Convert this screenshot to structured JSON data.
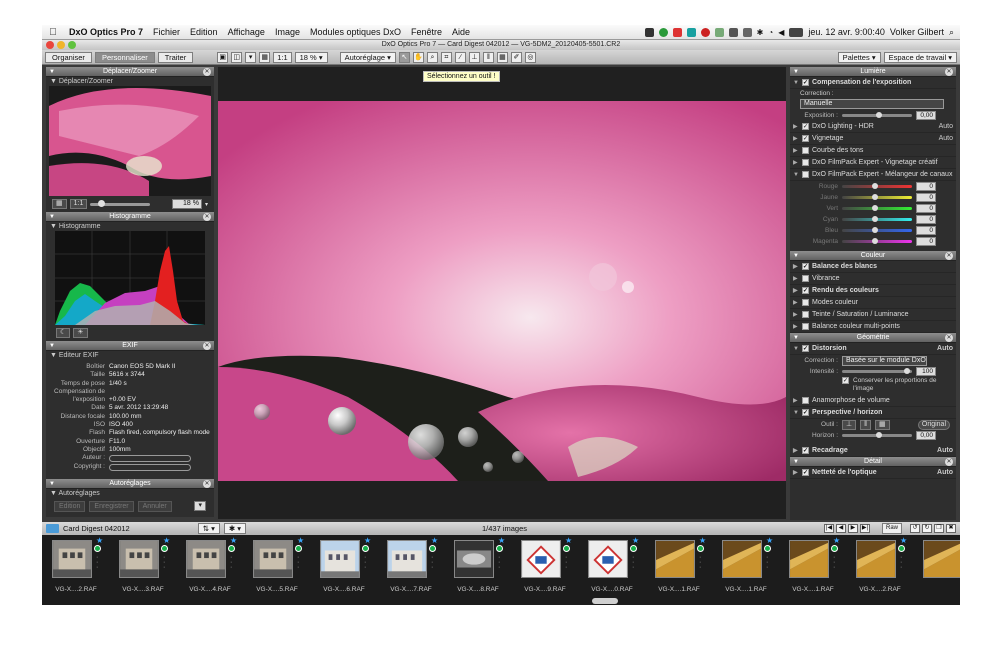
{
  "menubar": {
    "app_name": "DxO Optics Pro 7",
    "items": [
      "Fichier",
      "Edition",
      "Affichage",
      "Image",
      "Modules optiques DxO",
      "Fenêtre",
      "Aide"
    ],
    "datetime": "jeu. 12 avr.  9:00:40",
    "user": "Volker Gilbert"
  },
  "window": {
    "title": "DxO Optics Pro 7 — Card Digest 042012 — VG-5DM2_20120405-5501.CR2"
  },
  "modebar": {
    "tabs": [
      "Organiser",
      "Personnaliser",
      "Traiter"
    ],
    "active_tab": "Personnaliser",
    "one_to_one": "1:1",
    "zoom": "18 %",
    "autoreglage": "Autoréglage",
    "palettes": "Palettes",
    "workspace": "Espace de travail"
  },
  "tooltip": "Sélectionnez un outil !",
  "left": {
    "nav_title": "Déplacer/Zoomer",
    "nav_sub": "Déplacer/Zoomer",
    "nav_one_to_one": "1:1",
    "nav_zoom": "18 %",
    "histo_title": "Histogramme",
    "histo_sub": "Histogramme",
    "exif_title": "EXIF",
    "exif_sub": "Editeur EXIF",
    "exif": [
      {
        "k": "Boîtier",
        "v": "Canon EOS 5D Mark II"
      },
      {
        "k": "Taille",
        "v": "5616 x 3744"
      },
      {
        "k": "Temps de pose",
        "v": "1/40 s"
      },
      {
        "k": "Compensation de",
        "v": ""
      },
      {
        "k": "l'exposition",
        "v": "+0.00 EV"
      },
      {
        "k": "Date",
        "v": "5 avr. 2012 13:29:48"
      },
      {
        "k": "Distance focale",
        "v": "100.00 mm"
      },
      {
        "k": "ISO",
        "v": "ISO 400"
      },
      {
        "k": "Flash",
        "v": "Flash fired, compulsory flash mode"
      },
      {
        "k": "Ouverture",
        "v": "F11.0"
      },
      {
        "k": "Objectif",
        "v": "100mm"
      }
    ],
    "author_label": "Auteur :",
    "copyright_label": "Copyright :",
    "auto_title": "Autoréglages",
    "auto_sub": "Autoréglages",
    "auto_buttons": [
      "Edition",
      "Enregistrer",
      "Annuler"
    ]
  },
  "right": {
    "lumiere_title": "Lumière",
    "expo_comp": "Compensation de l'exposition",
    "correction_label": "Correction :",
    "correction_value": "Manuelle",
    "exposition_label": "Exposition :",
    "exposition_value": "0,00",
    "lighting": "DxO Lighting - HDR",
    "lighting_auto": "Auto",
    "vignetage": "Vignetage",
    "vignetage_auto": "Auto",
    "courbe": "Courbe des tons",
    "filmpack_vignette": "DxO FilmPack Expert - Vignetage créatif",
    "filmpack_mix": "DxO FilmPack Expert - Mélangeur de canaux",
    "mix_channels": [
      {
        "name": "Rouge",
        "value": "0"
      },
      {
        "name": "Jaune",
        "value": "0"
      },
      {
        "name": "Vert",
        "value": "0"
      },
      {
        "name": "Cyan",
        "value": "0"
      },
      {
        "name": "Bleu",
        "value": "0"
      },
      {
        "name": "Magenta",
        "value": "0"
      }
    ],
    "couleur_title": "Couleur",
    "balance": "Balance des blancs",
    "vibrance": "Vibrance",
    "rendu": "Rendu des couleurs",
    "modes": "Modes couleur",
    "teinte": "Teinte / Saturation / Luminance",
    "balance_multi": "Balance couleur multi-points",
    "geometrie_title": "Géométrie",
    "distorsion": "Distorsion",
    "distorsion_auto": "Auto",
    "dist_correction_label": "Correction :",
    "dist_correction_value": "Basée sur le module DxO",
    "intensite_label": "Intensité :",
    "intensite_value": "100",
    "conserver": "Conserver les proportions de l'image",
    "anamorphose": "Anamorphose de volume",
    "perspective": "Perspective / horizon",
    "outil_label": "Outil :",
    "original_btn": "Original",
    "horizon_label": "Horizon :",
    "horizon_value": "0,00",
    "recadrage": "Recadrage",
    "recadrage_auto": "Auto",
    "detail_title": "Détail",
    "nettete": "Netteté de l'optique",
    "nettete_auto": "Auto"
  },
  "filmbar": {
    "project": "Card Digest 042012",
    "count": "1/437 images",
    "raw_label": "Raw"
  },
  "film": [
    {
      "cap": "VG-X....2.RAF",
      "kind": "building"
    },
    {
      "cap": "VG-X....3.RAF",
      "kind": "building"
    },
    {
      "cap": "VG-X....4.RAF",
      "kind": "building"
    },
    {
      "cap": "VG-X....5.RAF",
      "kind": "building"
    },
    {
      "cap": "VG-X....6.RAF",
      "kind": "street"
    },
    {
      "cap": "VG-X....7.RAF",
      "kind": "street"
    },
    {
      "cap": "VG-X....8.RAF",
      "kind": "bw"
    },
    {
      "cap": "VG-X....9.RAF",
      "kind": "sign"
    },
    {
      "cap": "VG-X....0.RAF",
      "kind": "sign"
    },
    {
      "cap": "VG-X....1.RAF",
      "kind": "gold"
    },
    {
      "cap": "VG-X....1.RAF",
      "kind": "gold"
    },
    {
      "cap": "VG-X....1.RAF",
      "kind": "gold"
    },
    {
      "cap": "VG-X....2.RAF",
      "kind": "gold"
    },
    {
      "cap": "",
      "kind": "gold"
    }
  ]
}
